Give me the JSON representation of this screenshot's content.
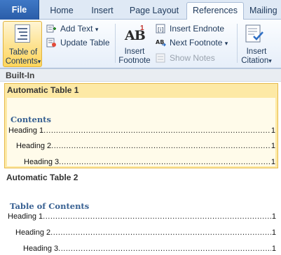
{
  "tabs": {
    "file": "File",
    "home": "Home",
    "insert": "Insert",
    "page_layout": "Page Layout",
    "references": "References",
    "mailings": "Mailing"
  },
  "ribbon": {
    "toc_button": {
      "line1": "Table of",
      "line2": "Contents",
      "arrow": "▾"
    },
    "add_text": {
      "label": "Add Text",
      "arrow": "▾"
    },
    "update_table": {
      "label": "Update Table"
    },
    "insert_footnote": {
      "glyph": "AB",
      "superscript": "1",
      "line1": "Insert",
      "line2": "Footnote"
    },
    "insert_endnote": {
      "label": "Insert Endnote"
    },
    "next_footnote": {
      "label": "Next Footnote",
      "arrow": "▾"
    },
    "show_notes": {
      "label": "Show Notes"
    },
    "insert_citation": {
      "line1": "Insert",
      "line2": "Citation",
      "arrow": "▾"
    }
  },
  "gallery": {
    "section_header": "Built-In",
    "items": [
      {
        "title": "Automatic Table 1",
        "selected": true,
        "preview_title": "Contents",
        "entries": [
          {
            "text": "Heading 1",
            "page": "1"
          },
          {
            "text": "Heading 2",
            "page": "1"
          },
          {
            "text": "Heading 3",
            "page": "1"
          }
        ]
      },
      {
        "title": "Automatic Table 2",
        "selected": false,
        "preview_title": "Table of Contents",
        "entries": [
          {
            "text": "Heading 1",
            "page": "1"
          },
          {
            "text": "Heading 2",
            "page": "1"
          },
          {
            "text": "Heading 3",
            "page": "1"
          }
        ]
      }
    ]
  },
  "colors": {
    "selected_fill": "#fde9a5",
    "selected_border": "#e6b94a",
    "heading_blue": "#365f91",
    "file_tab": "#2a5da8"
  }
}
